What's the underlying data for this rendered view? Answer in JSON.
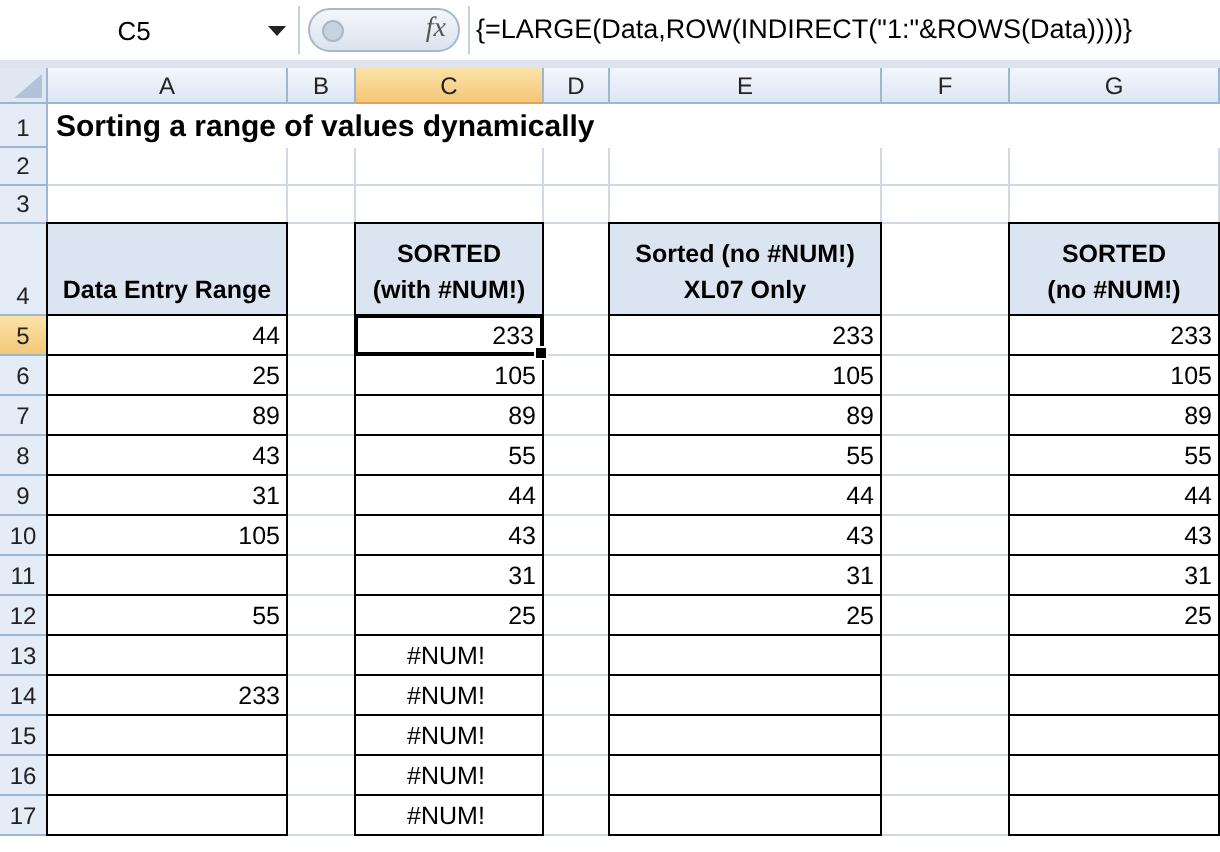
{
  "name_box": "C5",
  "function_label": "fx",
  "formula": "{=LARGE(Data,ROW(INDIRECT(\"1:\"&ROWS(Data))))}",
  "columns": [
    {
      "label": "A",
      "selected": false
    },
    {
      "label": "B",
      "selected": false
    },
    {
      "label": "C",
      "selected": true
    },
    {
      "label": "D",
      "selected": false
    },
    {
      "label": "E",
      "selected": false
    },
    {
      "label": "F",
      "selected": false
    },
    {
      "label": "G",
      "selected": false
    }
  ],
  "title": "Sorting a range of values dynamically",
  "rows": [
    {
      "label": "1",
      "selected": false,
      "cells": []
    },
    {
      "label": "2",
      "selected": false,
      "cells": []
    },
    {
      "label": "3",
      "selected": false,
      "cells": []
    },
    {
      "label": "4",
      "selected": false,
      "cells": [
        {
          "kind": "header",
          "lines": [
            "Data Entry Range"
          ]
        },
        {
          "kind": "blank"
        },
        {
          "kind": "header",
          "lines": [
            "SORTED",
            "(with #NUM!)"
          ]
        },
        {
          "kind": "blank"
        },
        {
          "kind": "header",
          "lines": [
            "Sorted (no #NUM!)",
            "XL07 Only"
          ]
        },
        {
          "kind": "blank"
        },
        {
          "kind": "header",
          "lines": [
            "SORTED",
            "(no #NUM!)"
          ]
        }
      ]
    },
    {
      "label": "5",
      "selected": true,
      "cells": [
        {
          "kind": "number",
          "text": "44"
        },
        {
          "kind": "blank"
        },
        {
          "kind": "number",
          "text": "233"
        },
        {
          "kind": "blank"
        },
        {
          "kind": "number",
          "text": "233"
        },
        {
          "kind": "blank"
        },
        {
          "kind": "number",
          "text": "233"
        }
      ]
    },
    {
      "label": "6",
      "selected": false,
      "cells": [
        {
          "kind": "number",
          "text": "25"
        },
        {
          "kind": "blank"
        },
        {
          "kind": "number",
          "text": "105"
        },
        {
          "kind": "blank"
        },
        {
          "kind": "number",
          "text": "105"
        },
        {
          "kind": "blank"
        },
        {
          "kind": "number",
          "text": "105"
        }
      ]
    },
    {
      "label": "7",
      "selected": false,
      "cells": [
        {
          "kind": "number",
          "text": "89"
        },
        {
          "kind": "blank"
        },
        {
          "kind": "number",
          "text": "89"
        },
        {
          "kind": "blank"
        },
        {
          "kind": "number",
          "text": "89"
        },
        {
          "kind": "blank"
        },
        {
          "kind": "number",
          "text": "89"
        }
      ]
    },
    {
      "label": "8",
      "selected": false,
      "cells": [
        {
          "kind": "number",
          "text": "43"
        },
        {
          "kind": "blank"
        },
        {
          "kind": "number",
          "text": "55"
        },
        {
          "kind": "blank"
        },
        {
          "kind": "number",
          "text": "55"
        },
        {
          "kind": "blank"
        },
        {
          "kind": "number",
          "text": "55"
        }
      ]
    },
    {
      "label": "9",
      "selected": false,
      "cells": [
        {
          "kind": "number",
          "text": "31"
        },
        {
          "kind": "blank"
        },
        {
          "kind": "number",
          "text": "44"
        },
        {
          "kind": "blank"
        },
        {
          "kind": "number",
          "text": "44"
        },
        {
          "kind": "blank"
        },
        {
          "kind": "number",
          "text": "44"
        }
      ]
    },
    {
      "label": "10",
      "selected": false,
      "cells": [
        {
          "kind": "number",
          "text": "105"
        },
        {
          "kind": "blank"
        },
        {
          "kind": "number",
          "text": "43"
        },
        {
          "kind": "blank"
        },
        {
          "kind": "number",
          "text": "43"
        },
        {
          "kind": "blank"
        },
        {
          "kind": "number",
          "text": "43"
        }
      ]
    },
    {
      "label": "11",
      "selected": false,
      "cells": [
        {
          "kind": "boxed"
        },
        {
          "kind": "blank"
        },
        {
          "kind": "number",
          "text": "31"
        },
        {
          "kind": "blank"
        },
        {
          "kind": "number",
          "text": "31"
        },
        {
          "kind": "blank"
        },
        {
          "kind": "number",
          "text": "31"
        }
      ]
    },
    {
      "label": "12",
      "selected": false,
      "cells": [
        {
          "kind": "number",
          "text": "55"
        },
        {
          "kind": "blank"
        },
        {
          "kind": "number",
          "text": "25"
        },
        {
          "kind": "blank"
        },
        {
          "kind": "number",
          "text": "25"
        },
        {
          "kind": "blank"
        },
        {
          "kind": "number",
          "text": "25"
        }
      ]
    },
    {
      "label": "13",
      "selected": false,
      "cells": [
        {
          "kind": "boxed"
        },
        {
          "kind": "blank"
        },
        {
          "kind": "error",
          "text": "#NUM!"
        },
        {
          "kind": "blank"
        },
        {
          "kind": "boxed"
        },
        {
          "kind": "blank"
        },
        {
          "kind": "boxed"
        }
      ]
    },
    {
      "label": "14",
      "selected": false,
      "cells": [
        {
          "kind": "number",
          "text": "233"
        },
        {
          "kind": "blank"
        },
        {
          "kind": "error",
          "text": "#NUM!"
        },
        {
          "kind": "blank"
        },
        {
          "kind": "boxed"
        },
        {
          "kind": "blank"
        },
        {
          "kind": "boxed"
        }
      ]
    },
    {
      "label": "15",
      "selected": false,
      "cells": [
        {
          "kind": "boxed"
        },
        {
          "kind": "blank"
        },
        {
          "kind": "error",
          "text": "#NUM!"
        },
        {
          "kind": "blank"
        },
        {
          "kind": "boxed"
        },
        {
          "kind": "blank"
        },
        {
          "kind": "boxed"
        }
      ]
    },
    {
      "label": "16",
      "selected": false,
      "cells": [
        {
          "kind": "boxed"
        },
        {
          "kind": "blank"
        },
        {
          "kind": "error",
          "text": "#NUM!"
        },
        {
          "kind": "blank"
        },
        {
          "kind": "boxed"
        },
        {
          "kind": "blank"
        },
        {
          "kind": "boxed"
        }
      ]
    },
    {
      "label": "17",
      "selected": false,
      "cells": [
        {
          "kind": "boxed"
        },
        {
          "kind": "blank"
        },
        {
          "kind": "error",
          "text": "#NUM!"
        },
        {
          "kind": "blank"
        },
        {
          "kind": "boxed"
        },
        {
          "kind": "blank"
        },
        {
          "kind": "boxed"
        }
      ]
    }
  ]
}
